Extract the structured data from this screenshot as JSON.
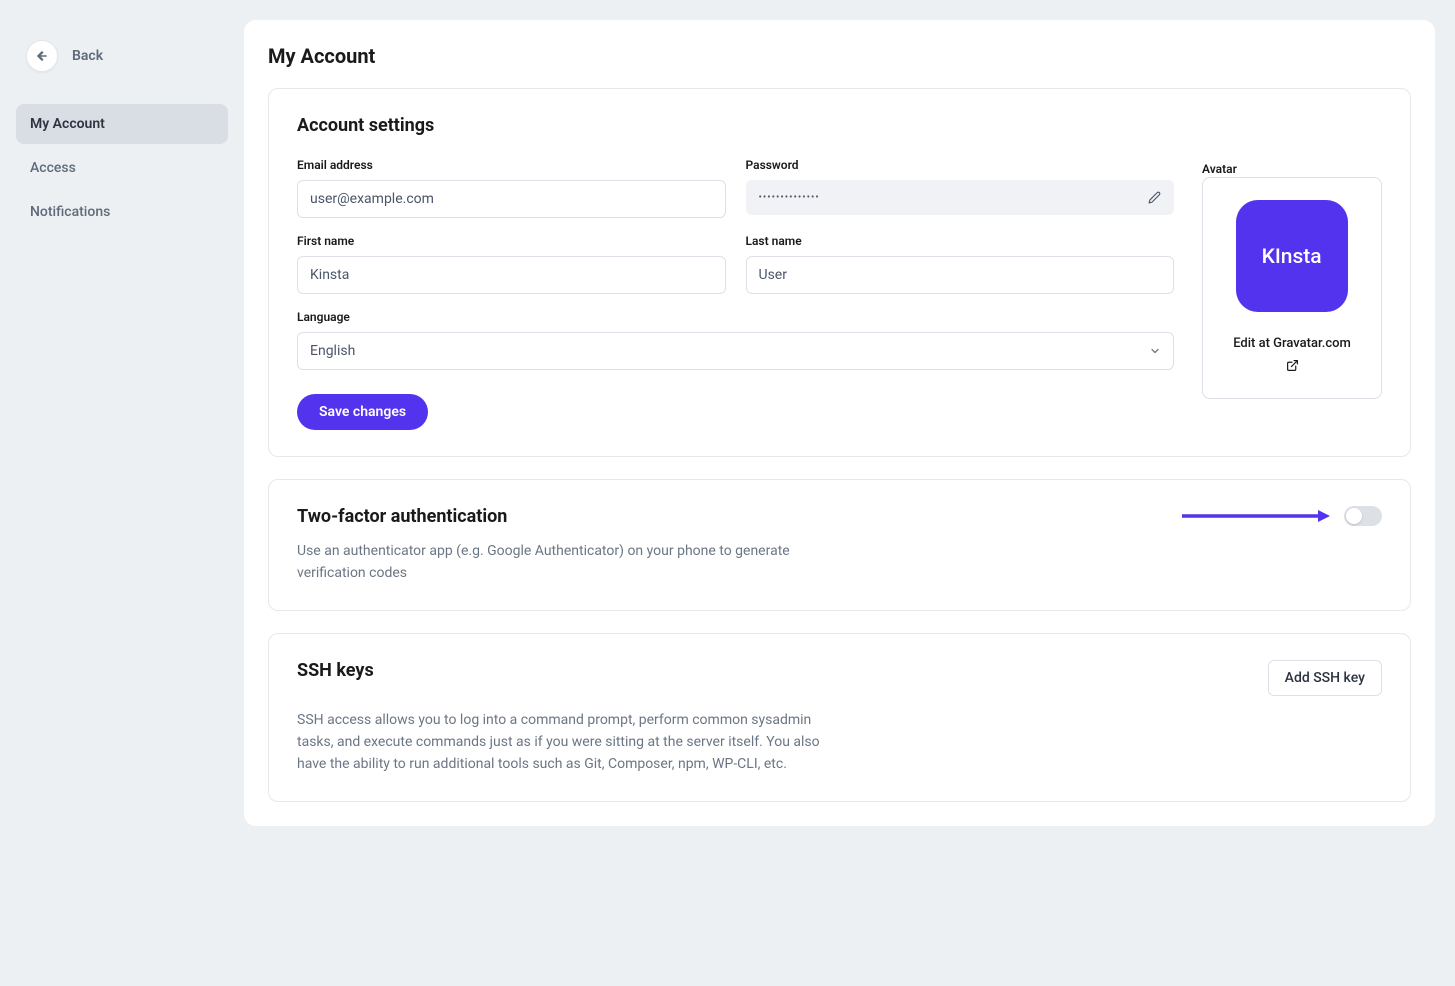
{
  "sidebar": {
    "back_label": "Back",
    "items": [
      {
        "label": "My Account",
        "active": true
      },
      {
        "label": "Access",
        "active": false
      },
      {
        "label": "Notifications",
        "active": false
      }
    ]
  },
  "page": {
    "title": "My Account"
  },
  "account_settings": {
    "heading": "Account settings",
    "fields": {
      "email_label": "Email address",
      "email_value": "user@example.com",
      "password_label": "Password",
      "password_mask": "••••••••••••••",
      "first_name_label": "First name",
      "first_name_value": "Kinsta",
      "last_name_label": "Last name",
      "last_name_value": "User",
      "language_label": "Language",
      "language_value": "English"
    },
    "save_button": "Save changes",
    "avatar": {
      "label": "Avatar",
      "logo_text": "KInsta",
      "gravatar_text": "Edit at Gravatar.com"
    }
  },
  "twofa": {
    "heading": "Two-factor authentication",
    "description": "Use an authenticator app (e.g. Google Authenticator) on your phone to generate verification codes",
    "enabled": false
  },
  "ssh": {
    "heading": "SSH keys",
    "add_button": "Add SSH key",
    "description": "SSH access allows you to log into a command prompt, perform common sysadmin tasks, and execute commands just as if you were sitting at the server itself. You also have the ability to run additional tools such as Git, Composer, npm, WP-CLI, etc."
  },
  "colors": {
    "accent": "#5333ed"
  }
}
